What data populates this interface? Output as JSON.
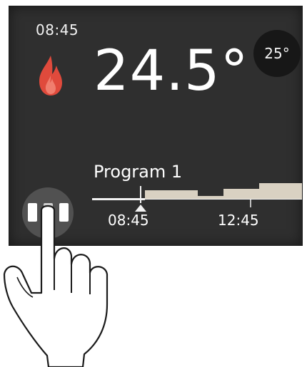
{
  "status": {
    "time": "08:45",
    "current_temperature": "24.5°",
    "setpoint": "25°",
    "heating_icon": "flame-icon",
    "flame_color": "#e04a3c"
  },
  "program": {
    "name": "Program 1",
    "current_time_marker": "08:45",
    "tick_labels": [
      "08:45",
      "12:45"
    ],
    "bar_color": "#d9d1c2",
    "line_color": "#f2f2f2"
  },
  "mode_button": {
    "icon": "mode-toggle-icon"
  },
  "overlay": {
    "icon": "pointing-hand-icon"
  },
  "colors": {
    "screen_bg": "#2f2f2f",
    "setpoint_bg": "#171717",
    "button_bg": "#515151"
  }
}
